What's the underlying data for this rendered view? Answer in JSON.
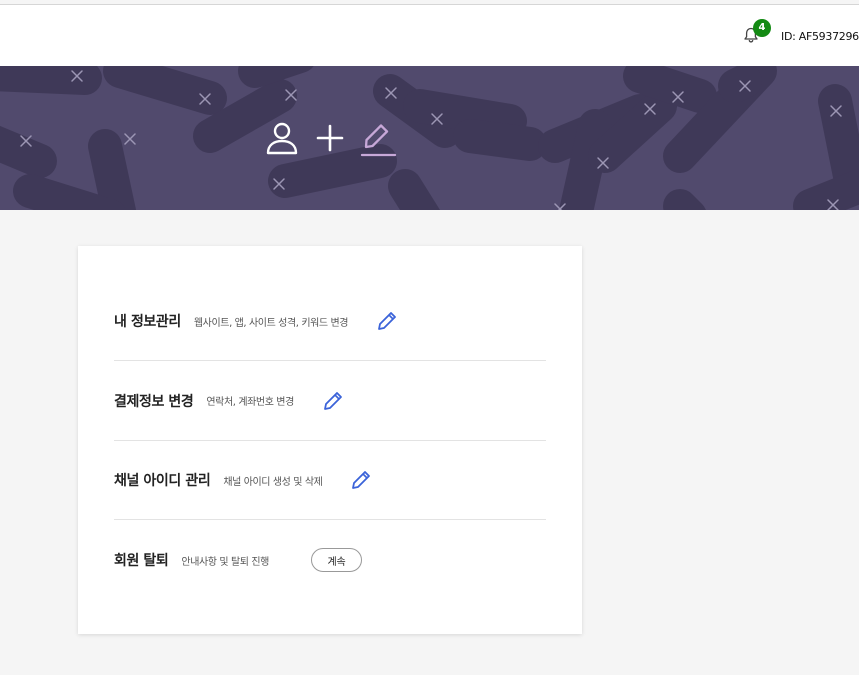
{
  "header": {
    "notification_count": "4",
    "user_id": "ID: AF5937296"
  },
  "banner": {
    "icons": [
      "user-icon",
      "plus-icon",
      "edit-icon"
    ],
    "background_color": "#514a6d",
    "accent_color": "#c7a8d8"
  },
  "settings": {
    "items": [
      {
        "title": "내 정보관리",
        "description": "웹사이트, 앱, 사이트 성격, 키워드 변경",
        "action": "edit-icon"
      },
      {
        "title": "결제정보 변경",
        "description": "연락처, 계좌번호 변경",
        "action": "edit-icon"
      },
      {
        "title": "채널 아이디 관리",
        "description": "채널 아이디 생성 및 삭제",
        "action": "edit-icon"
      },
      {
        "title": "회원 탈퇴",
        "description": "안내사항 및 탈퇴 진행",
        "action_label": "계속"
      }
    ]
  },
  "colors": {
    "edit_icon": "#3b63d9",
    "badge": "#138a13"
  }
}
